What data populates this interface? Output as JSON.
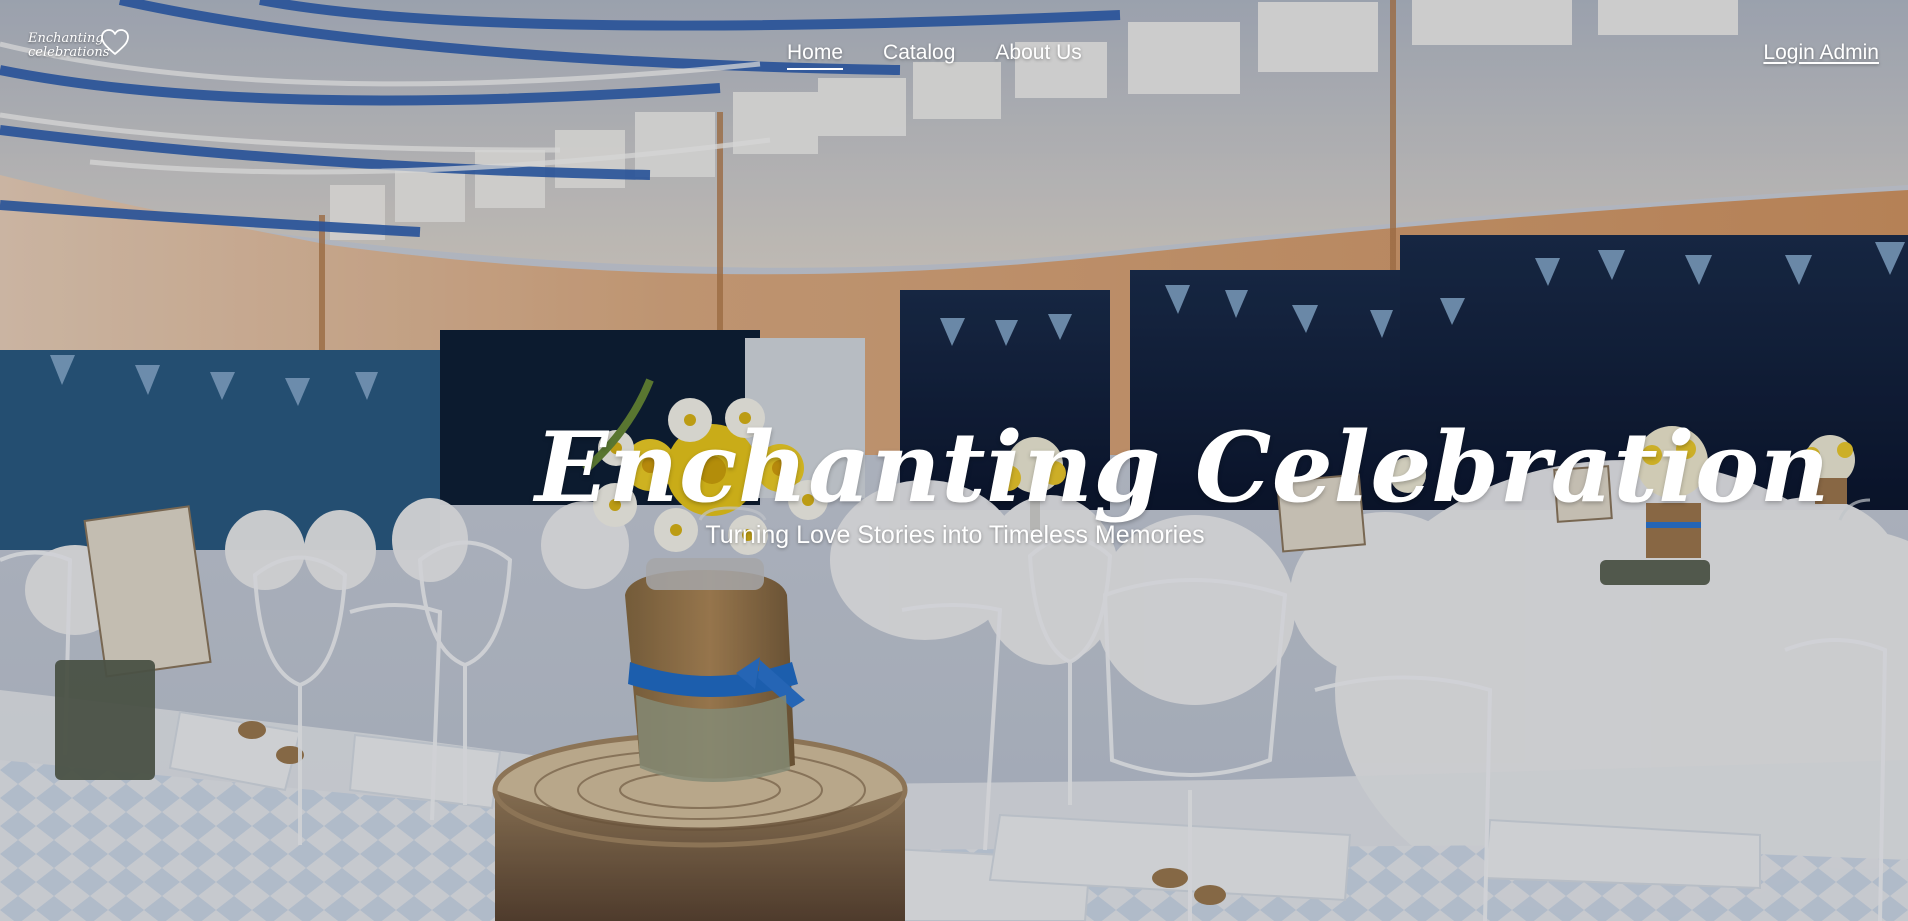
{
  "brand": {
    "logo_text": "Enchanting\ncelebrations"
  },
  "nav": {
    "links": [
      {
        "label": "Home"
      },
      {
        "label": "Catalog"
      },
      {
        "label": "About Us"
      }
    ],
    "login_label": "Login Admin"
  },
  "hero": {
    "title": "Enchanting Celebration",
    "subtitle": "Turning Love Stories into Timeless Memories"
  },
  "colors": {
    "text": "#ffffff",
    "accent_blue": "#1f6fd1",
    "navy": "#0e1d3a",
    "warm_wall": "#d99a67",
    "chair_white": "#f1f2f5"
  },
  "icons": {
    "logo": "heart-logo-icon"
  }
}
